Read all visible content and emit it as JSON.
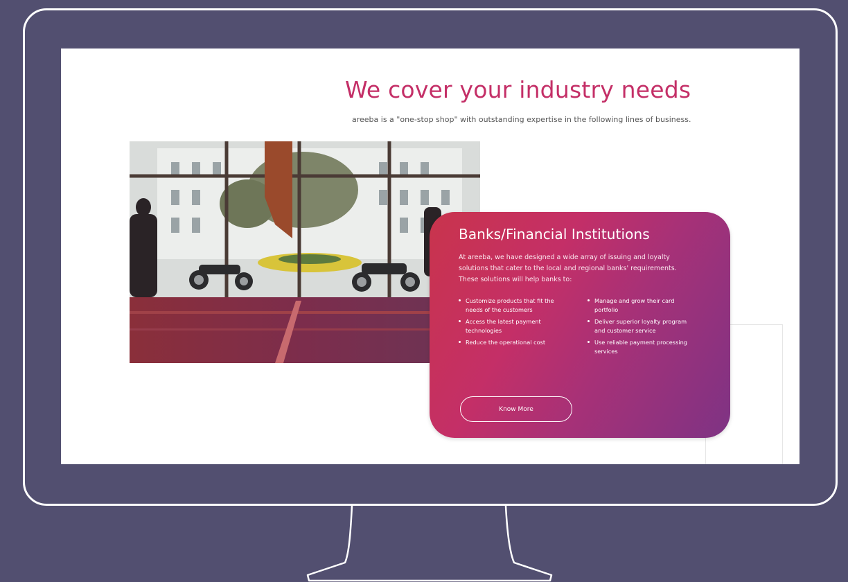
{
  "page": {
    "headline": "We cover your industry needs",
    "subline": "areeba is a \"one-stop shop\" with outstanding expertise in the following lines of business."
  },
  "card": {
    "title": "Banks/Financial Institutions",
    "description": "At areeba, we have designed a wide array of issuing and loyalty solutions that cater to the local and regional banks' requirements. These solutions will help banks to:",
    "left_list": [
      "Customize products that fit the needs of the customers",
      "Access the latest payment technologies",
      "Reduce the operational cost"
    ],
    "right_list": [
      "Manage and grow their card portfolio",
      "Deliver superior loyalty program and customer service",
      "Use reliable payment processing services"
    ],
    "button_label": "Know More"
  },
  "colors": {
    "background": "#524f70",
    "accent": "#c42f67",
    "card_gradient_end": "#7e3384"
  }
}
